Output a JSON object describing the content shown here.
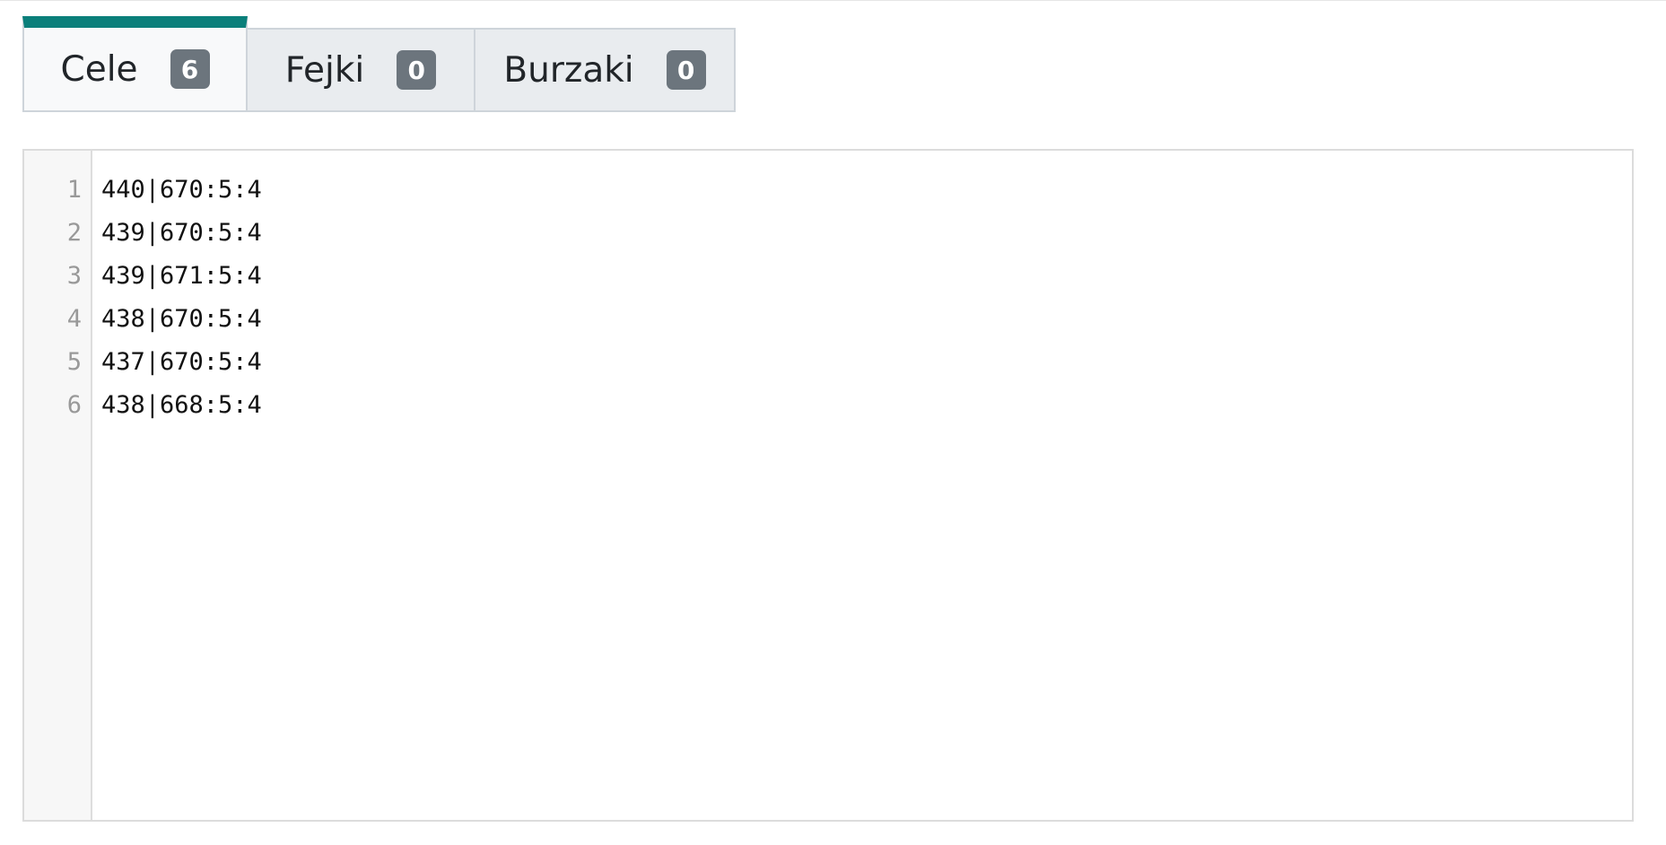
{
  "tabs": [
    {
      "label": "Cele",
      "count": "6",
      "active": true
    },
    {
      "label": "Fejki",
      "count": "0",
      "active": false
    },
    {
      "label": "Burzaki",
      "count": "0",
      "active": false
    }
  ],
  "editor": {
    "line_numbers": [
      "1",
      "2",
      "3",
      "4",
      "5",
      "6"
    ],
    "lines": [
      "440|670:5:4",
      "439|670:5:4",
      "439|671:5:4",
      "438|670:5:4",
      "437|670:5:4",
      "438|668:5:4"
    ]
  },
  "colors": {
    "active_tab_accent": "#0a7f7a",
    "badge_bg": "#6c757d"
  }
}
